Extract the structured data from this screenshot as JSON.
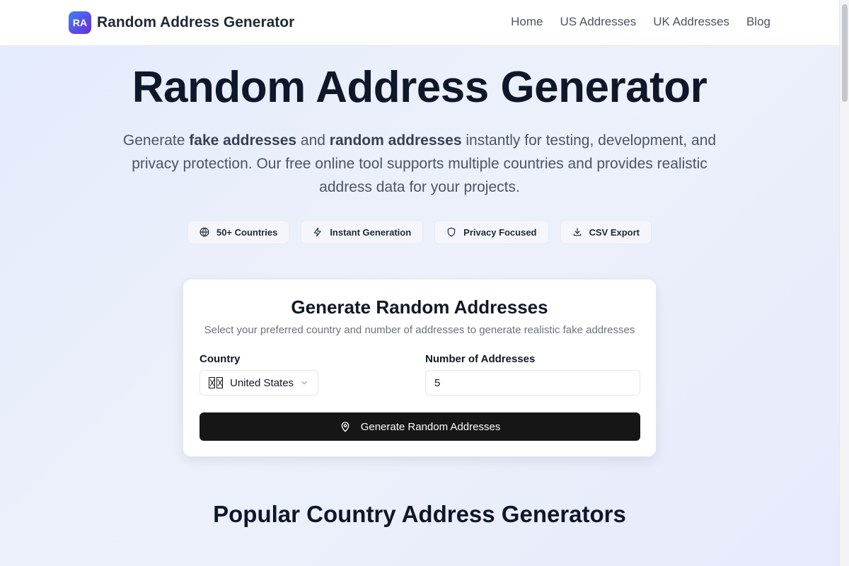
{
  "header": {
    "logo_text": "RA",
    "brand_name": "Random Address Generator",
    "nav": [
      "Home",
      "US Addresses",
      "UK Addresses",
      "Blog"
    ]
  },
  "hero": {
    "title": "Random Address Generator",
    "subtitle": {
      "p1": "Generate ",
      "b1": "fake addresses",
      "p2": " and ",
      "b2": "random addresses",
      "p3": " instantly for testing, development, and privacy protection. Our free online tool supports multiple countries and provides realistic address data for your projects."
    },
    "features": [
      {
        "icon": "globe-icon",
        "label": "50+ Countries"
      },
      {
        "icon": "lightning-icon",
        "label": "Instant Generation"
      },
      {
        "icon": "shield-icon",
        "label": "Privacy Focused"
      },
      {
        "icon": "download-icon",
        "label": "CSV Export"
      }
    ]
  },
  "generator": {
    "title": "Generate Random Addresses",
    "description": "Select your preferred country and number of addresses to generate realistic fake addresses",
    "country_label": "Country",
    "country_value": "United States",
    "count_label": "Number of Addresses",
    "count_value": "5",
    "button_label": "Generate Random Addresses"
  },
  "popular": {
    "title": "Popular Country Address Generators"
  },
  "colors": {
    "accent_gradient_start": "#3b82f6",
    "accent_gradient_end": "#6d28d9",
    "button_bg": "#161616"
  }
}
